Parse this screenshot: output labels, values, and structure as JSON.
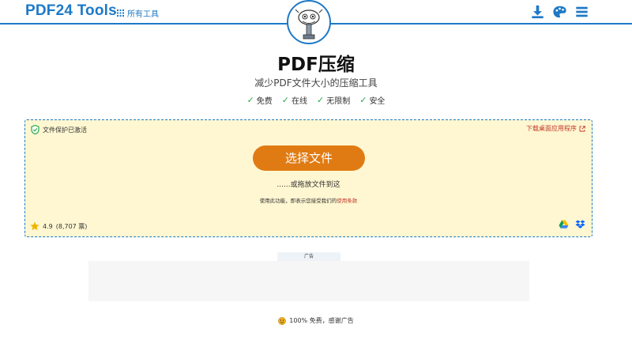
{
  "header": {
    "brand": "PDF24 Tools",
    "all_tools": "所有工具",
    "icons": [
      "download-icon",
      "palette-icon",
      "menu-icon"
    ]
  },
  "tool": {
    "title": "PDF压缩",
    "subtitle": "减少PDF文件大小的压缩工具",
    "features": [
      "免费",
      "在线",
      "无限制",
      "安全"
    ]
  },
  "upload": {
    "protection": "文件保护已激活",
    "apps_link": "下载桌面应用程序",
    "choose_button": "选择文件",
    "drop_text": "......或拖放文件到这",
    "terms_prefix": "使用此功能，即表示您接受我们的",
    "terms_link": "使用条款",
    "rating": "4.9",
    "rating_count": "(8,707 票)"
  },
  "ad": {
    "label": "广告"
  },
  "footer": {
    "free_note": "100% 免费，感谢广告"
  },
  "colors": {
    "accent": "#1e79c6",
    "button": "#e07b14",
    "upload_bg": "#fff7d1",
    "check": "#2aa84a"
  }
}
